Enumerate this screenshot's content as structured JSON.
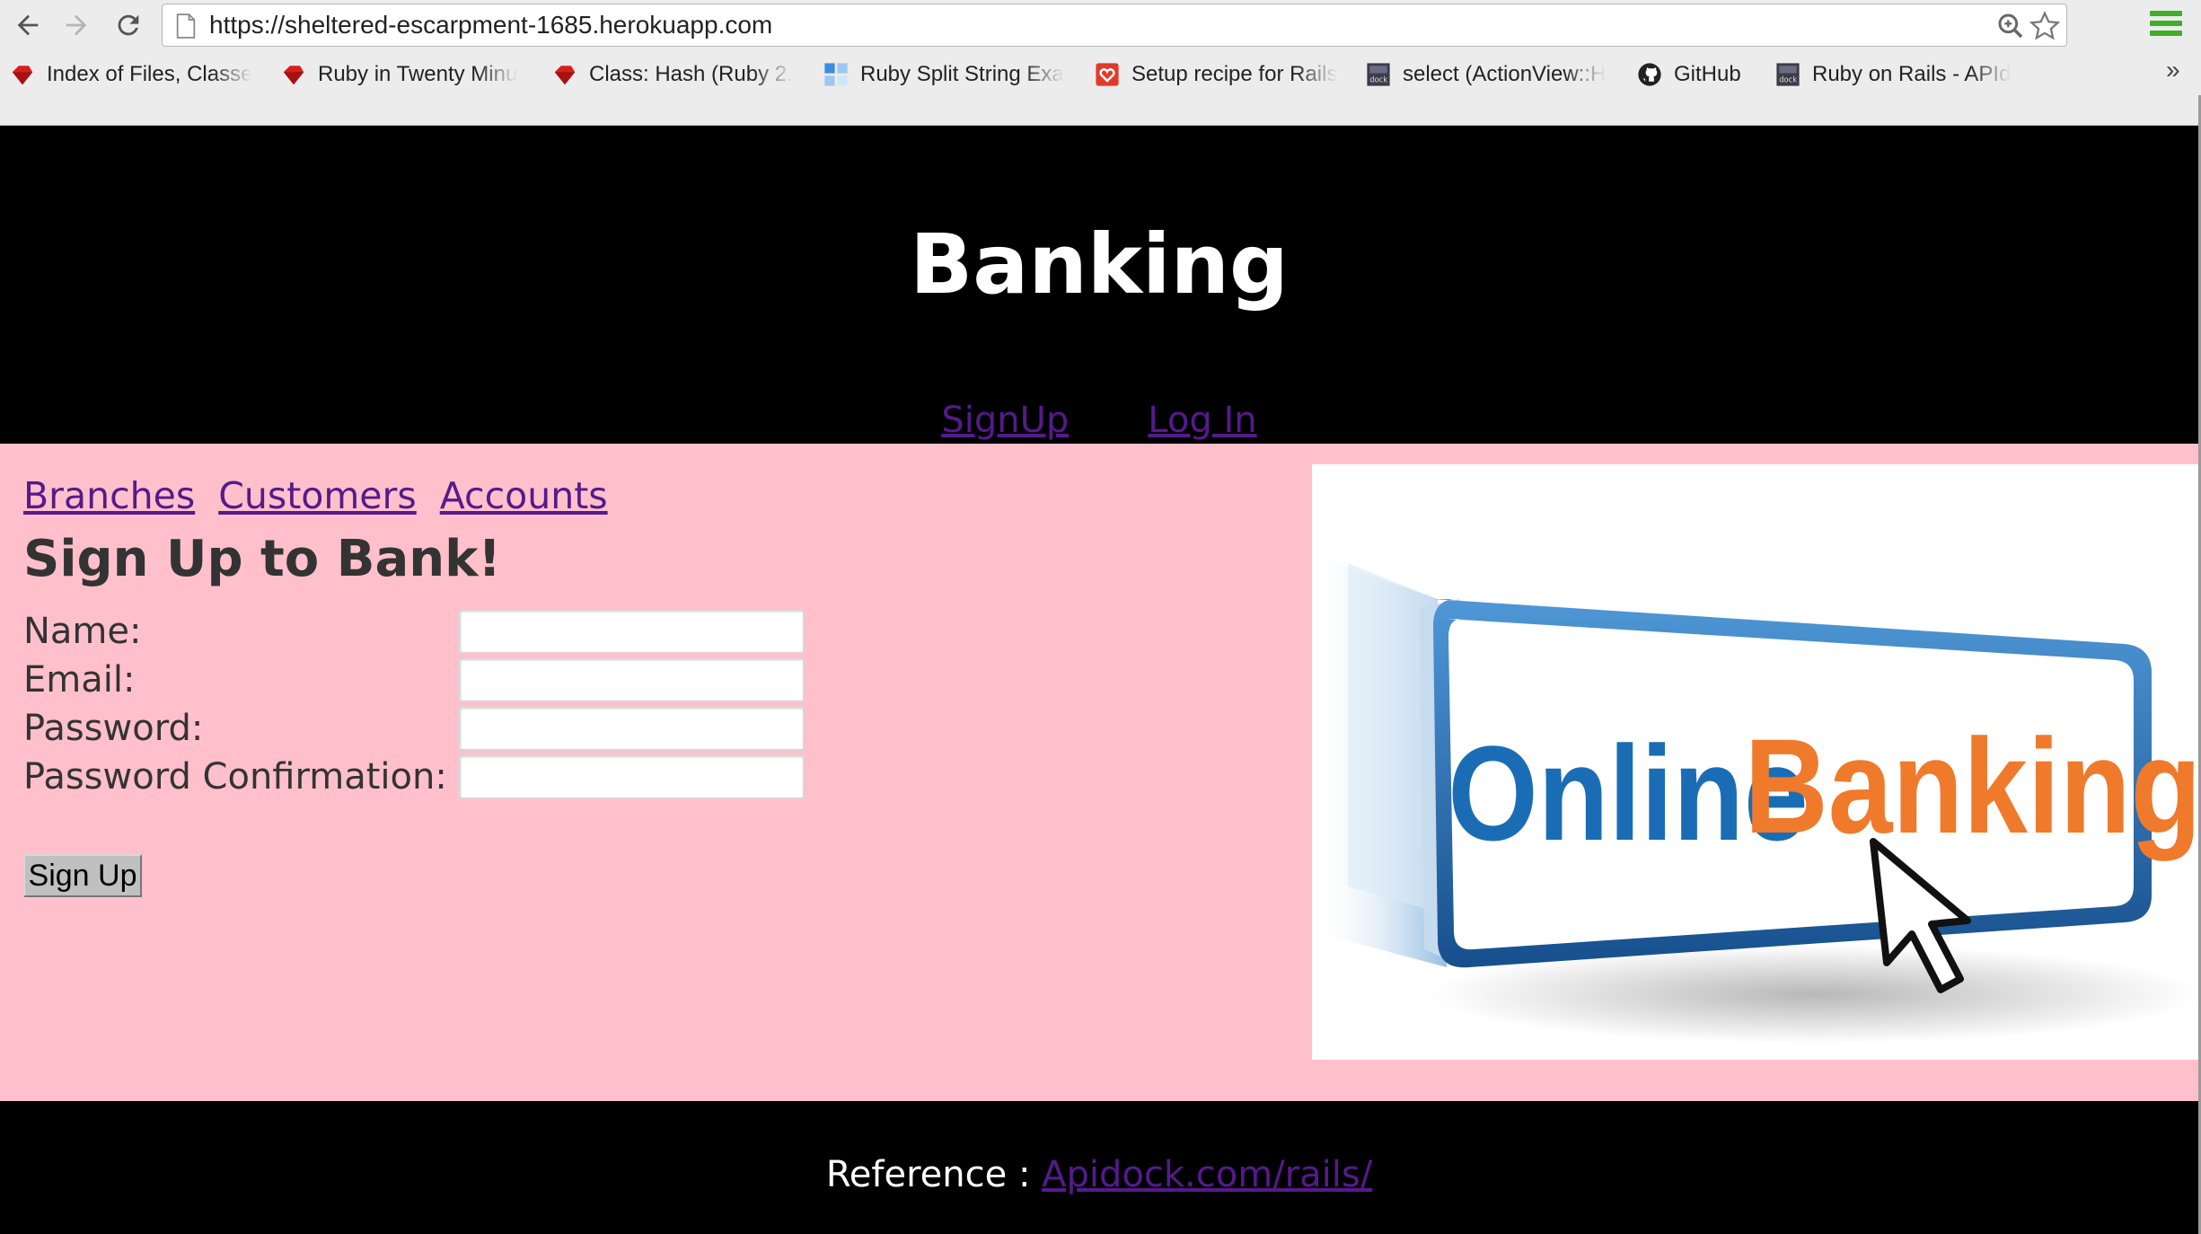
{
  "browser": {
    "url": "https://sheltered-escarpment-1685.herokuapp.com",
    "bookmarks": [
      {
        "label": "Index of Files, Classe",
        "icon": "ruby-gem-icon"
      },
      {
        "label": "Ruby in Twenty Minu",
        "icon": "ruby-gem-icon"
      },
      {
        "label": "Class: Hash (Ruby 2.",
        "icon": "ruby-gem-icon"
      },
      {
        "label": "Ruby Split String Exa",
        "icon": "blue-squares-icon"
      },
      {
        "label": "Setup recipe for Rails",
        "icon": "heart-shield-icon"
      },
      {
        "label": "select (ActionView::H",
        "icon": "apidock-icon"
      },
      {
        "label": "GitHub",
        "icon": "github-icon"
      },
      {
        "label": "Ruby on Rails - APId",
        "icon": "apidock-icon"
      }
    ],
    "overflow": "»"
  },
  "header": {
    "title": "Banking",
    "nav": [
      "SignUp",
      "Log In"
    ]
  },
  "sidebar": {
    "links": [
      "Branches",
      "Customers",
      "Accounts"
    ]
  },
  "form": {
    "title": "Sign Up to Bank!",
    "fields": [
      {
        "label": "Name:",
        "value": ""
      },
      {
        "label": "Email:",
        "value": ""
      },
      {
        "label": "Password:",
        "value": ""
      },
      {
        "label": "Password Confirmation:",
        "value": ""
      }
    ],
    "submit": "Sign Up"
  },
  "banner": {
    "word1": "Online",
    "word2": "Banking",
    "colors": {
      "word1": "#1a6db5",
      "word2": "#f07a2c",
      "frame": "#1f6fb3"
    }
  },
  "footer": {
    "prefix": "Reference : ",
    "link": "Apidock.com/rails/"
  },
  "colors": {
    "page_bg": "#ffc0cb",
    "header_bg": "#000000",
    "link": "#551a8b"
  }
}
